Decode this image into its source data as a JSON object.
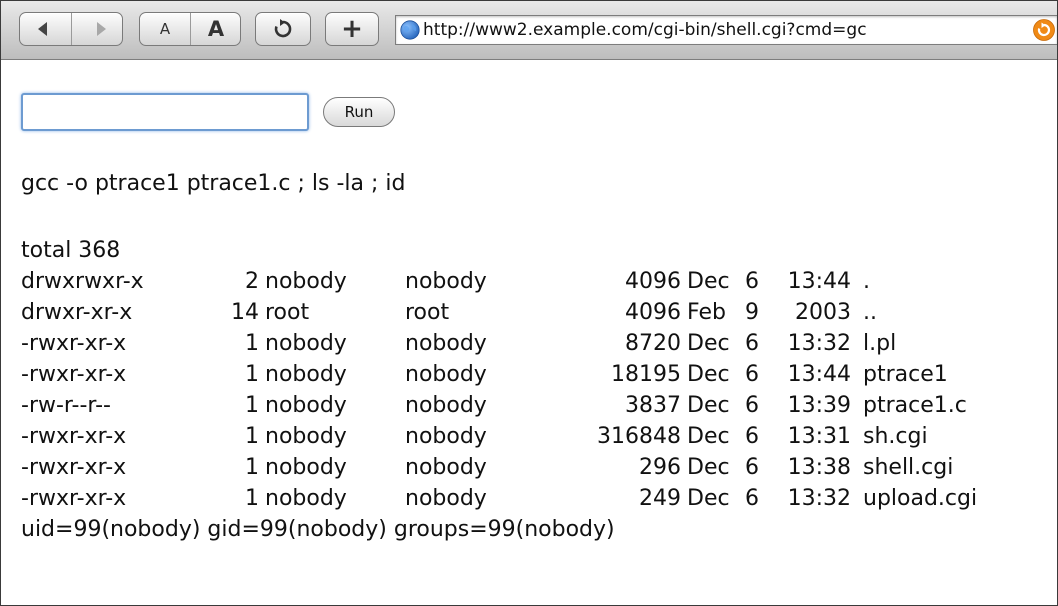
{
  "toolbar": {
    "back_icon": "back-arrow-icon",
    "forward_icon": "forward-arrow-icon",
    "text_smaller_label": "A",
    "text_bigger_label": "A",
    "reload_icon": "reload-icon",
    "add_bookmark_label": "+",
    "url": "http://www2.example.com/cgi-bin/shell.cgi?cmd=gc",
    "accent_blue": "#2c78d0",
    "accent_orange": "#f08a16"
  },
  "form": {
    "input_value": "",
    "run_label": "Run"
  },
  "output": {
    "command": "gcc -o ptrace1 ptrace1.c ; ls -la ; id",
    "total": "total 368",
    "rows": [
      {
        "perm": "drwxrwxr-x",
        "links": "2",
        "owner": "nobody",
        "group": "nobody",
        "size": "4096",
        "month": "Dec",
        "day": "6",
        "time": "13:44",
        "name": "."
      },
      {
        "perm": "drwxr-xr-x",
        "links": "14",
        "owner": "root",
        "group": "root",
        "size": "4096",
        "month": "Feb",
        "day": "9",
        "time": "2003",
        "name": ".."
      },
      {
        "perm": "-rwxr-xr-x",
        "links": "1",
        "owner": "nobody",
        "group": "nobody",
        "size": "8720",
        "month": "Dec",
        "day": "6",
        "time": "13:32",
        "name": "l.pl"
      },
      {
        "perm": "-rwxr-xr-x",
        "links": "1",
        "owner": "nobody",
        "group": "nobody",
        "size": "18195",
        "month": "Dec",
        "day": "6",
        "time": "13:44",
        "name": "ptrace1"
      },
      {
        "perm": "-rw-r--r--",
        "links": "1",
        "owner": "nobody",
        "group": "nobody",
        "size": "3837",
        "month": "Dec",
        "day": "6",
        "time": "13:39",
        "name": "ptrace1.c"
      },
      {
        "perm": "-rwxr-xr-x",
        "links": "1",
        "owner": "nobody",
        "group": "nobody",
        "size": "316848",
        "month": "Dec",
        "day": "6",
        "time": "13:31",
        "name": "sh.cgi"
      },
      {
        "perm": "-rwxr-xr-x",
        "links": "1",
        "owner": "nobody",
        "group": "nobody",
        "size": "296",
        "month": "Dec",
        "day": "6",
        "time": "13:38",
        "name": "shell.cgi"
      },
      {
        "perm": "-rwxr-xr-x",
        "links": "1",
        "owner": "nobody",
        "group": "nobody",
        "size": "249",
        "month": "Dec",
        "day": "6",
        "time": "13:32",
        "name": "upload.cgi"
      }
    ],
    "id_line": "uid=99(nobody) gid=99(nobody) groups=99(nobody)"
  }
}
